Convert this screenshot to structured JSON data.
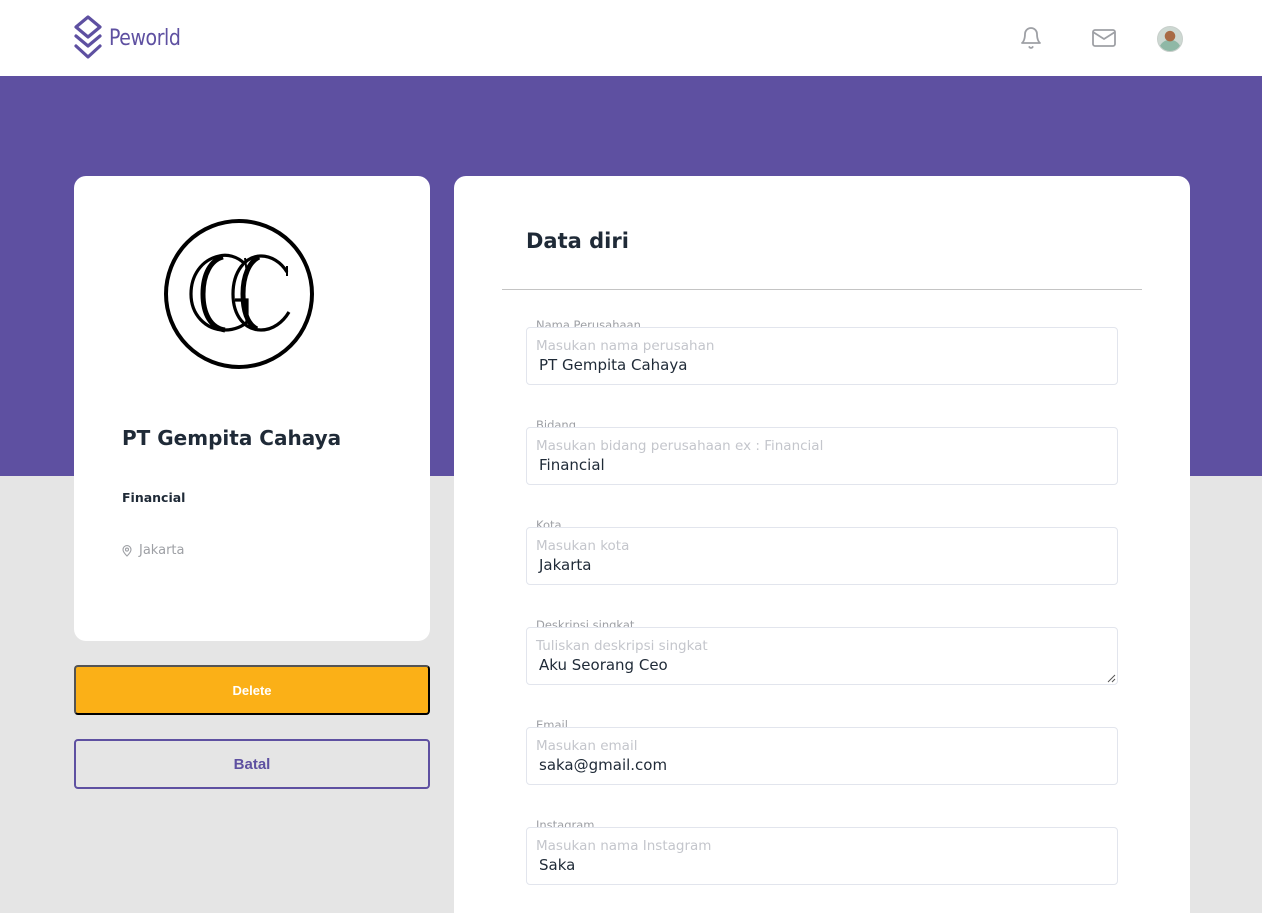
{
  "navbar": {
    "brand_name": "Peworld",
    "icons": [
      "bell-icon",
      "mail-icon"
    ],
    "brand_color": "#5e50a1"
  },
  "profile": {
    "company_name": "PT Gempita Cahaya",
    "field": "Financial",
    "location": "Jakarta",
    "logo_letters": "GC"
  },
  "actions": {
    "delete_label": "Delete",
    "cancel_label": "Batal"
  },
  "form": {
    "title": "Data diri",
    "fields": [
      {
        "label": "Nama Perusahaan",
        "placeholder": "Masukan nama perusahan",
        "value": "PT Gempita Cahaya"
      },
      {
        "label": "Bidang",
        "placeholder": "Masukan bidang perusahaan ex : Financial",
        "value": "Financial"
      },
      {
        "label": "Kota",
        "placeholder": "Masukan kota",
        "value": "Jakarta"
      },
      {
        "label": "Deskripsi singkat",
        "placeholder": "Tuliskan deskripsi singkat",
        "value": "Aku Seorang Ceo"
      },
      {
        "label": "Email",
        "placeholder": "Masukan email",
        "value": "saka@gmail.com"
      },
      {
        "label": "Instagram",
        "placeholder": "Masukan nama Instagram",
        "value": "Saka"
      }
    ]
  },
  "colors": {
    "primary": "#5e50a1",
    "accent": "#fbb017",
    "background": "#e5e5e5"
  }
}
